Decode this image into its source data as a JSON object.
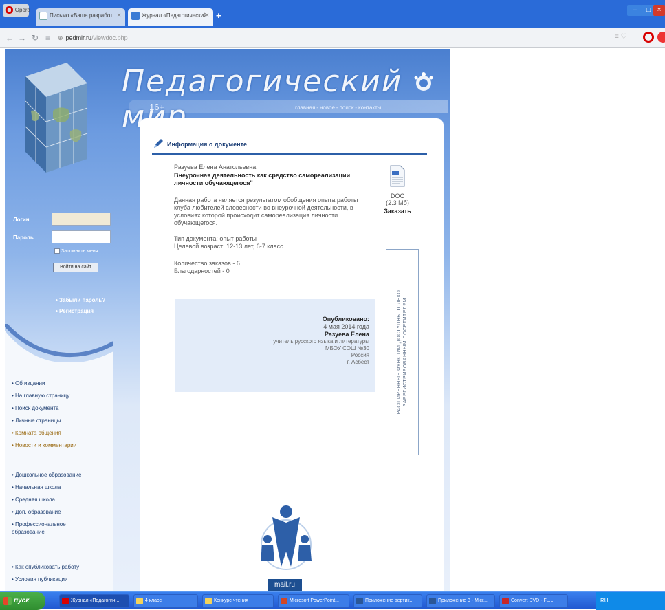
{
  "browser": {
    "app_button": "Opera",
    "tabs": [
      {
        "label": "Письмо «Ваша разработ…"
      },
      {
        "label": "Журнал «Педагогический…"
      }
    ],
    "url": {
      "host": "pedmir.ru",
      "path": "/viewdoc.php"
    }
  },
  "site": {
    "title": "Педагогический мир",
    "age_badge": "16+",
    "top_nav": [
      "главная",
      "новое",
      "поиск",
      "контакты"
    ]
  },
  "login": {
    "login_label": "Логин",
    "password_label": "Пароль",
    "remember_label": "Запомнить меня",
    "signin_button": "Войти на сайт",
    "forgot_link": "• Забыли пароль?",
    "register_link": "• Регистрация"
  },
  "menus": {
    "group1": [
      {
        "label": "• Об издании",
        "highlight": false
      },
      {
        "label": "• На главную страницу",
        "highlight": false
      },
      {
        "label": "• Поиск документа",
        "highlight": false
      },
      {
        "label": "• Личные страницы",
        "highlight": false
      },
      {
        "label": "• Комната общения",
        "highlight": true
      },
      {
        "label": "• Новости и комментарии",
        "highlight": true
      }
    ],
    "group2": [
      "• Дошкольное образование",
      "• Начальная школа",
      "• Средняя школа",
      "• Доп. образование",
      "• Профессиональное образование"
    ],
    "group3": [
      "• Как опубликовать работу",
      "• Условия публикации"
    ]
  },
  "document": {
    "section_title": "Информация о документе",
    "author": "Разуева Елена Анатольевна",
    "title": "Внеурочная деятельность как средство самореализации личности обучающегося\"",
    "description": "Данная работа является результатом обобщения опыта работы клуба любителей словесности во внеурочной деятельности, в условиях которой происходит самореализация личности обучающегося.",
    "doc_type": "Тип документа: опыт работы",
    "target_age": "Целевой возраст: 12-13 лет, 6-7 класс",
    "orders": "Количество заказов - 6.",
    "thanks": "Благодарностей - 0",
    "download": {
      "format": "DOC",
      "size": "(2.3 Мб)",
      "order_link": "Заказать"
    },
    "side_notice": "РАСШИРЕННЫЕ ФУНКЦИИ ДОСТУПНЫ ТОЛЬКО ЗАРЕГИСТРИРОВАННЫМ ПОСЕТИТЕЛЯМ"
  },
  "published": {
    "label": "Опубликовано:",
    "date": "4 мая 2014 года",
    "name": "Разуева Елена",
    "lines": [
      "учитель русского языка и литературы",
      "МБОУ СОШ №30",
      "Россия",
      "г. Асбест"
    ]
  },
  "counter": {
    "label": "mail.ru"
  },
  "taskbar": {
    "start": "пуск",
    "tasks": [
      "Журнал «Педагогич...",
      "4 класс",
      "Конкурс чтения",
      "Microsoft PowerPoint...",
      "Приложение вертик...",
      "Приложение 3 - Micr...",
      "Convert DVD - FL..."
    ],
    "tray": "RU"
  },
  "colors": {
    "accent": "#2c5fa8",
    "title_bar": "#2a6bd8",
    "publish_box": "#e3ecf9"
  }
}
